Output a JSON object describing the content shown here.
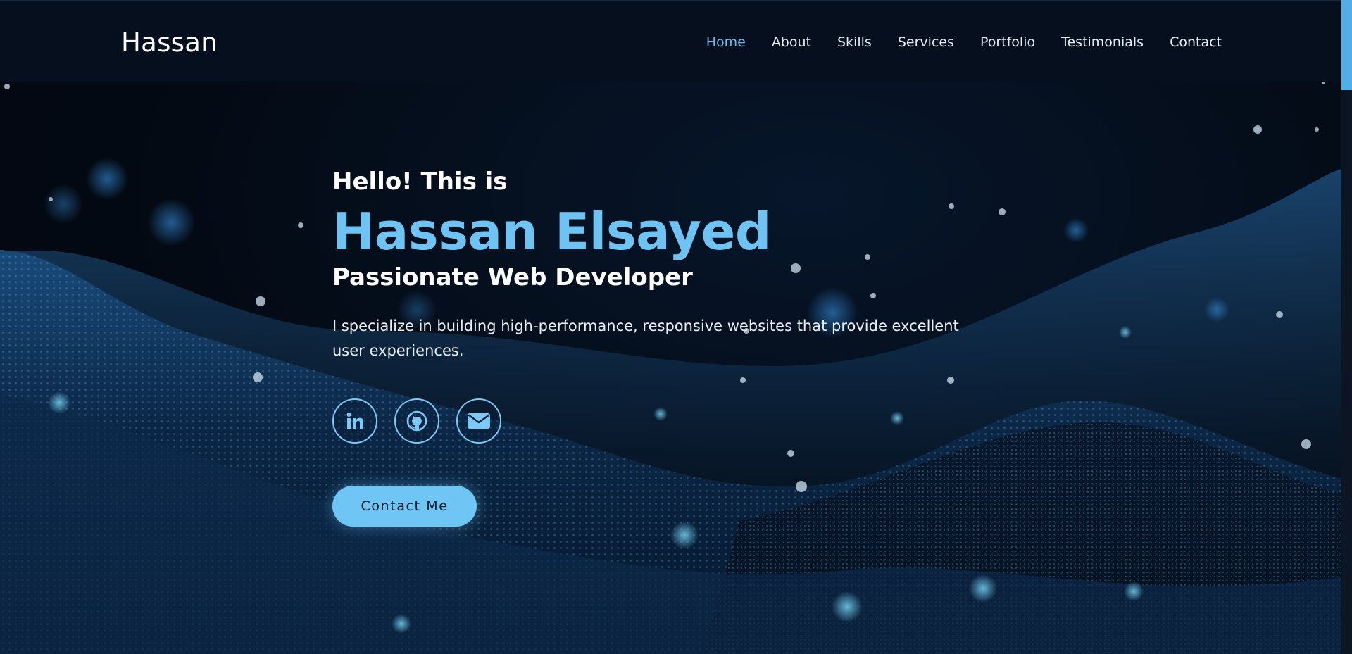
{
  "brand": "Hassan",
  "nav": {
    "items": [
      {
        "label": "Home",
        "active": true
      },
      {
        "label": "About"
      },
      {
        "label": "Skills"
      },
      {
        "label": "Services"
      },
      {
        "label": "Portfolio"
      },
      {
        "label": "Testimonials"
      },
      {
        "label": "Contact"
      }
    ]
  },
  "hero": {
    "greeting": "Hello! This is",
    "name": "Hassan Elsayed",
    "role": "Passionate Web Developer",
    "description": "I specialize in building high-performance, responsive websites that provide excellent user experiences.",
    "socials": [
      {
        "icon": "linkedin-icon"
      },
      {
        "icon": "github-icon"
      },
      {
        "icon": "envelope-icon"
      }
    ],
    "cta_label": "Contact Me"
  },
  "colors": {
    "accent": "#6fc3f3",
    "background": "#050b16",
    "navbar": "#050f1e",
    "text": "#ffffff"
  }
}
